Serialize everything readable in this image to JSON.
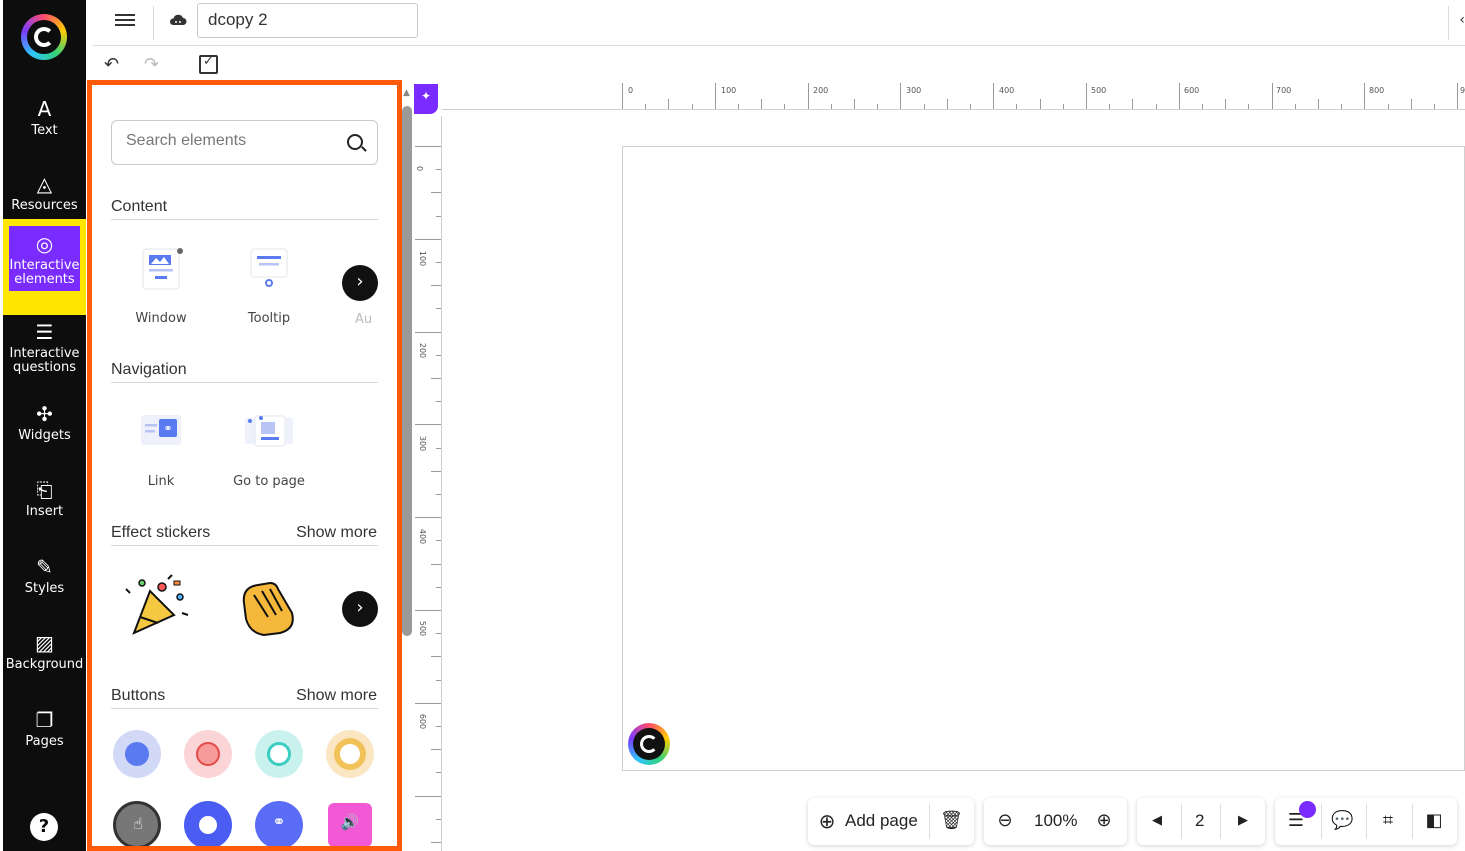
{
  "colors": {
    "accent": "#7a2bff",
    "panel_border": "#ff5a0a",
    "highlight": "#ffe600",
    "sidebar_bg": "#0d0d0d"
  },
  "sidebar": {
    "items": [
      {
        "label": "Text",
        "icon": "text-icon"
      },
      {
        "label": "Resources",
        "icon": "shapes-icon"
      },
      {
        "label": "Interactive elements",
        "icon": "interactive-touch-icon",
        "active": true
      },
      {
        "label": "Interactive questions",
        "icon": "checklist-icon"
      },
      {
        "label": "Widgets",
        "icon": "puzzle-icon"
      },
      {
        "label": "Insert",
        "icon": "insert-icon"
      },
      {
        "label": "Styles",
        "icon": "styles-icon"
      },
      {
        "label": "Background",
        "icon": "background-pattern-icon"
      },
      {
        "label": "Pages",
        "icon": "pages-icon"
      }
    ],
    "help": "?"
  },
  "header": {
    "project_title": "dcopy 2"
  },
  "panel": {
    "search_placeholder": "Search elements",
    "content": {
      "title": "Content",
      "items": [
        "Window",
        "Tooltip",
        "Au"
      ]
    },
    "navigation": {
      "title": "Navigation",
      "items": [
        "Link",
        "Go to page"
      ]
    },
    "effect_stickers": {
      "title": "Effect stickers",
      "show_more": "Show more"
    },
    "buttons": {
      "title": "Buttons",
      "show_more": "Show more"
    }
  },
  "ruler": {
    "top": [
      "0",
      "100",
      "200",
      "300",
      "400",
      "500",
      "600",
      "700",
      "800",
      "9"
    ],
    "left": [
      "0",
      "100",
      "200",
      "300",
      "400",
      "500",
      "600"
    ]
  },
  "bottom": {
    "add_page": "Add page",
    "zoom": "100%",
    "page_number": "2"
  }
}
